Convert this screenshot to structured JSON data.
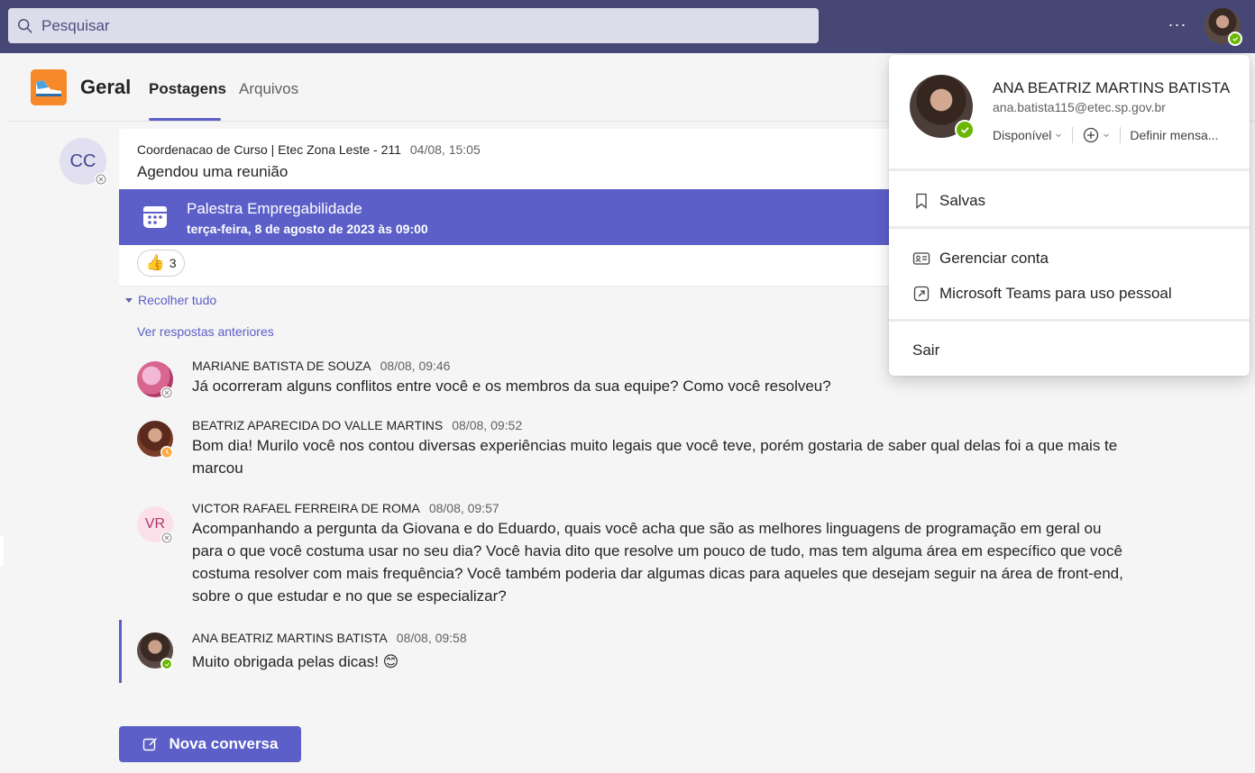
{
  "topbar": {
    "search_placeholder": "Pesquisar",
    "more_label": "···"
  },
  "channel": {
    "title": "Geral",
    "tabs": [
      "Postagens",
      "Arquivos"
    ],
    "active_tab": "Postagens"
  },
  "post": {
    "avatar_initials": "CC",
    "author": "Coordenacao de Curso | Etec Zona Leste - 211",
    "time": "04/08, 15:05",
    "body": "Agendou uma reunião",
    "meeting": {
      "title": "Palestra Empregabilidade",
      "date": "terça-feira, 8 de agosto de 2023 às 09:00"
    },
    "reaction": {
      "emoji": "👍",
      "count": "3"
    },
    "collapse_label": "Recolher tudo",
    "see_previous_label": "Ver respostas anteriores"
  },
  "replies": [
    {
      "author": "MARIANE BATISTA DE SOUZA",
      "time": "08/08, 09:46",
      "text": "Já ocorreram alguns conflitos entre você e os membros da sua equipe? Como você resolveu?",
      "status": "offline"
    },
    {
      "author": "BEATRIZ APARECIDA DO VALLE MARTINS",
      "time": "08/08, 09:52",
      "text": "Bom dia! Murilo você nos contou diversas experiências muito legais que você teve, porém gostaria de saber qual delas foi a que mais te marcou",
      "status": "away"
    },
    {
      "author": "VICTOR RAFAEL FERREIRA DE ROMA",
      "time": "08/08, 09:57",
      "initials": "VR",
      "text": "Acompanhando a pergunta da Giovana e do Eduardo, quais você acha que são as melhores linguagens de programação em geral ou para o que você costuma usar no seu dia? Você havia dito que resolve um pouco de tudo, mas tem alguma área em específico que você costuma resolver com mais frequência? Você também poderia dar algumas dicas para aqueles que desejam seguir na área de front-end, sobre o que estudar e no que se especializar?",
      "status": "offline"
    },
    {
      "author": "ANA BEATRIZ MARTINS BATISTA",
      "time": "08/08, 09:58",
      "text": "Muito obrigada pelas dicas! 😊",
      "status": "available"
    }
  ],
  "new_conversation_label": "Nova conversa",
  "profile": {
    "name": "ANA BEATRIZ MARTINS BATISTA",
    "email": "ana.batista115@etec.sp.gov.br",
    "status": "Disponível",
    "set_message": "Definir mensa...",
    "menu": [
      {
        "label": "Salvas",
        "icon": "bookmark-icon"
      },
      {
        "label": "Gerenciar conta",
        "icon": "id-card-icon"
      },
      {
        "label": "Microsoft Teams para uso pessoal",
        "icon": "external-link-icon"
      },
      {
        "label": "Sair",
        "icon": ""
      }
    ]
  },
  "colors": {
    "topbar": "#464775",
    "accent": "#5b5fc7",
    "available": "#6bb700",
    "away": "#ffaa44"
  }
}
